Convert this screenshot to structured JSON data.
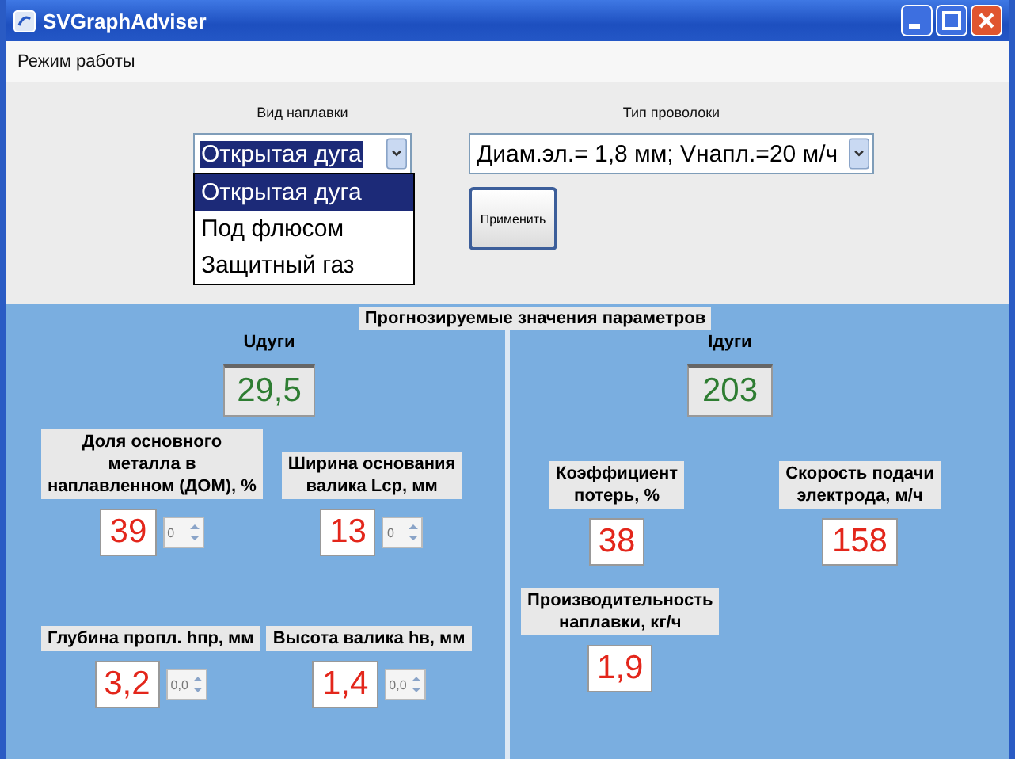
{
  "window": {
    "title": "SVGraphAdviser"
  },
  "menu": [
    {
      "label": "Режим работы"
    }
  ],
  "surfacing_type": {
    "label": "Вид наплавки",
    "value": "Открытая дуга",
    "expanded": true,
    "options": [
      {
        "label": "Открытая дуга",
        "selected": true
      },
      {
        "label": "Под флюсом",
        "selected": false
      },
      {
        "label": "Защитный газ",
        "selected": false
      }
    ]
  },
  "wire_type": {
    "label": "Тип проволоки",
    "value": "Диам.эл.= 1,8 мм; Vнапл.=20 м/ч"
  },
  "apply_button": {
    "label": "Применить"
  },
  "group_title": "Прогнозируемые значения параметров",
  "left_panel": {
    "rows": [
      [
        {
          "kind": "primary",
          "label": "Uдуги",
          "value": "29,5"
        }
      ],
      [
        {
          "kind": "result",
          "label": "Доля основного\nметалла в\nнаплавленном (ДОМ), %",
          "value": "39",
          "spinner": {
            "value": "0",
            "disabled": true
          }
        },
        {
          "kind": "result",
          "label": "Ширина основания\nвалика Lср, мм",
          "value": "13",
          "spinner": {
            "value": "0",
            "disabled": true
          }
        }
      ],
      [
        {
          "kind": "result",
          "label": "Глубина пропл. hпр, мм",
          "value": "3,2",
          "spinner": {
            "value": "0,0",
            "disabled": true
          }
        },
        {
          "kind": "result",
          "label": "Высота валика hв, мм",
          "value": "1,4",
          "spinner": {
            "value": "0,0",
            "disabled": true
          }
        }
      ]
    ]
  },
  "right_panel": {
    "rows": [
      [
        {
          "kind": "primary",
          "label": "Iдуги",
          "value": "203"
        }
      ],
      [
        {
          "kind": "result",
          "label": "Коэффициент\nпотерь, %",
          "value": "38"
        },
        {
          "kind": "result",
          "label": "Скорость подачи\nэлектрода, м/ч",
          "value": "158"
        }
      ],
      [
        {
          "kind": "result",
          "label": "Производительность\nнаплавки, кг/ч",
          "value": "1,9"
        }
      ]
    ]
  }
}
